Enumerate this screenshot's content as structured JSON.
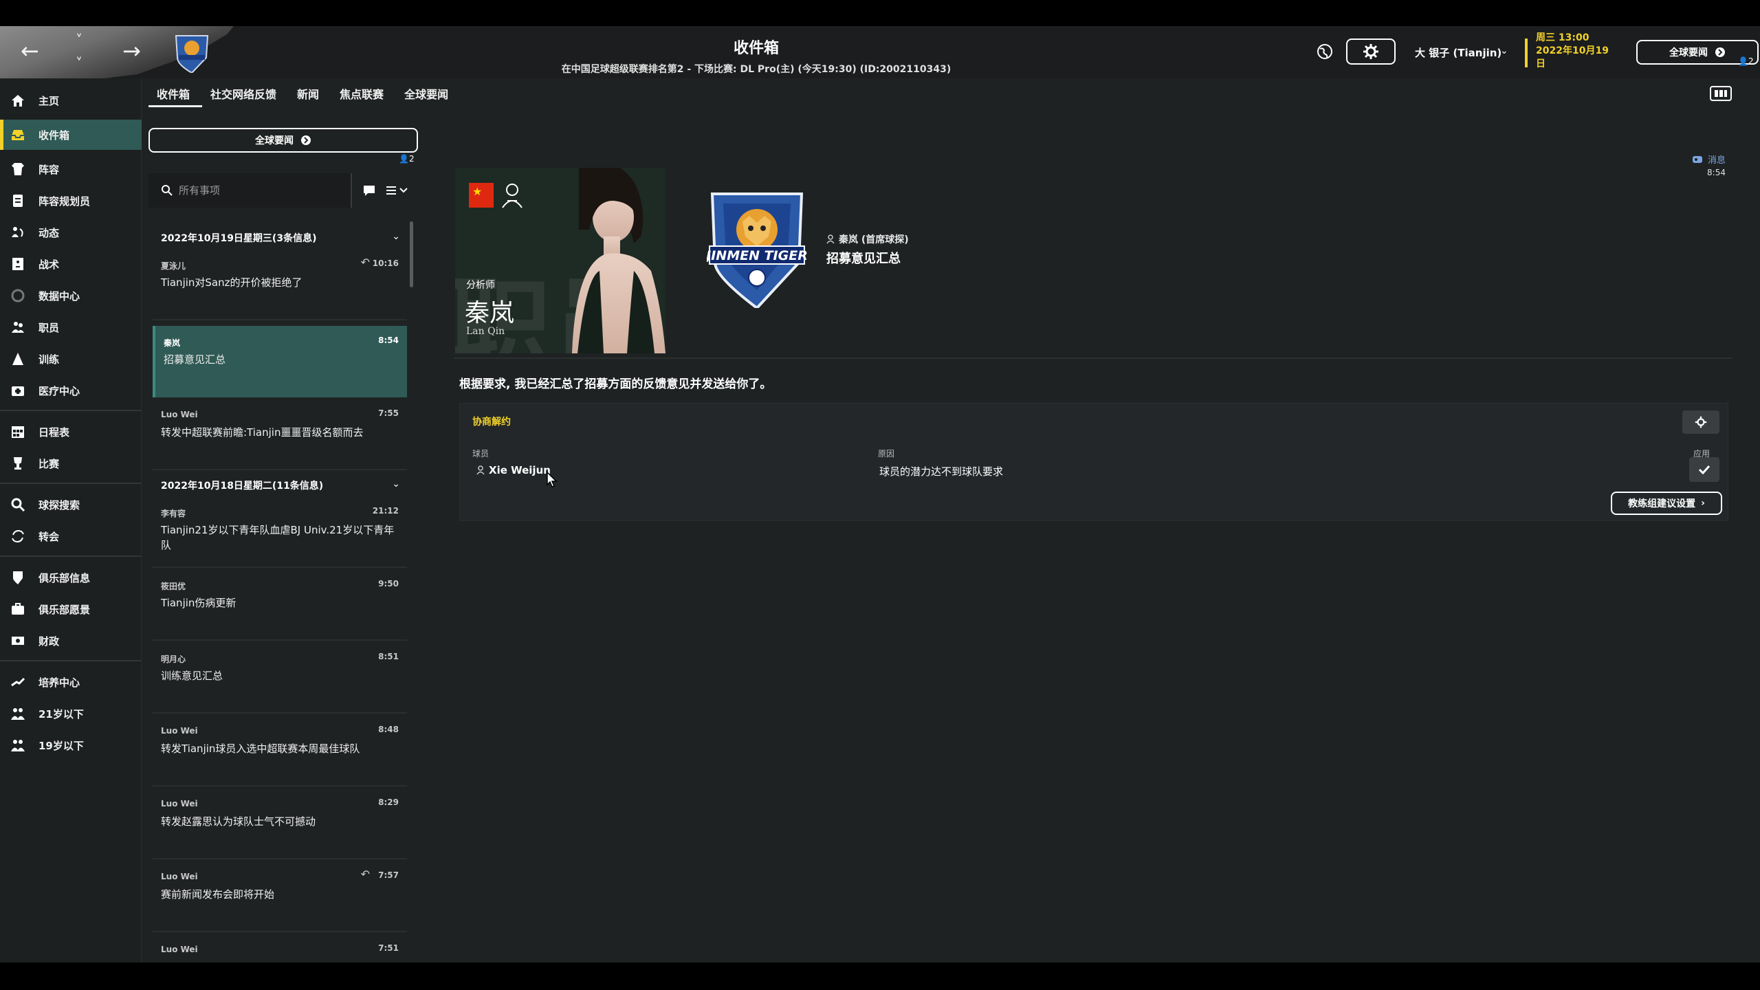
{
  "header": {
    "title": "收件箱",
    "subtitle": "在中国足球超级联赛排名第2 - 下场比赛: DL Pro(主) (今天19:30) (ID:2002110343)",
    "user_name": "大 银子 (Tianjin)",
    "date": "周三 13:00\n2022年10月19日",
    "news_button": "全球要闻",
    "news_badge": "2"
  },
  "sidebar": {
    "items": [
      {
        "label": "主页",
        "icon": "home-icon"
      },
      {
        "label": "收件箱",
        "icon": "inbox-icon"
      },
      {
        "label": "阵容",
        "icon": "squad-icon"
      },
      {
        "label": "阵容规划员",
        "icon": "planner-icon"
      },
      {
        "label": "动态",
        "icon": "dynamics-icon"
      },
      {
        "label": "战术",
        "icon": "tactics-icon"
      },
      {
        "label": "数据中心",
        "icon": "data-icon"
      },
      {
        "label": "职员",
        "icon": "staff-icon"
      },
      {
        "label": "训练",
        "icon": "training-icon"
      },
      {
        "label": "医疗中心",
        "icon": "medical-icon"
      },
      {
        "label": "日程表",
        "icon": "calendar-icon"
      },
      {
        "label": "比赛",
        "icon": "trophy-icon"
      },
      {
        "label": "球探搜索",
        "icon": "scout-icon"
      },
      {
        "label": "转会",
        "icon": "transfer-icon"
      },
      {
        "label": "俱乐部信息",
        "icon": "club-info-icon"
      },
      {
        "label": "俱乐部愿景",
        "icon": "club-vision-icon"
      },
      {
        "label": "财政",
        "icon": "finance-icon"
      },
      {
        "label": "培养中心",
        "icon": "development-icon"
      },
      {
        "label": "21岁以下",
        "icon": "u21-icon"
      },
      {
        "label": "19岁以下",
        "icon": "u19-icon"
      }
    ]
  },
  "tabs": [
    {
      "label": "收件箱"
    },
    {
      "label": "社交网络反馈"
    },
    {
      "label": "新闻"
    },
    {
      "label": "焦点联赛"
    },
    {
      "label": "全球要闻"
    }
  ],
  "inbox": {
    "news_button": "全球要闻",
    "badge": "2",
    "search_placeholder": "所有事项",
    "groups": [
      {
        "title": "2022年10月19日星期三(3条信息)"
      },
      {
        "title": "2022年10月18日星期二(11条信息)"
      }
    ],
    "messages": [
      {
        "sender": "夏泳儿",
        "time": "10:16",
        "subject": "Tianjin对Sanz的开价被拒绝了",
        "reply": true
      },
      {
        "sender": "秦岚",
        "time": "8:54",
        "subject": "招募意见汇总",
        "reply": false
      },
      {
        "sender": "Luo Wei",
        "time": "7:55",
        "subject": "转发中超联赛前瞻:Tianjin噩噩晋级名额而去",
        "reply": false
      },
      {
        "sender": "李有容",
        "time": "21:12",
        "subject": "Tianjin21岁以下青年队血虐BJ Univ.21岁以下青年队",
        "reply": false
      },
      {
        "sender": "筱田优",
        "time": "9:50",
        "subject": "Tianjin伤病更新",
        "reply": false
      },
      {
        "sender": "明月心",
        "time": "8:51",
        "subject": "训练意见汇总",
        "reply": false
      },
      {
        "sender": "Luo Wei",
        "time": "8:48",
        "subject": "转发Tianjin球员入选中超联赛本周最佳球队",
        "reply": false
      },
      {
        "sender": "Luo Wei",
        "time": "8:29",
        "subject": "转发赵露思认为球队士气不可撼动",
        "reply": false
      },
      {
        "sender": "Luo Wei",
        "time": "7:57",
        "subject": "赛前新闻发布会即将开始",
        "reply": true
      },
      {
        "sender": "Luo Wei",
        "time": "7:51",
        "subject": "",
        "reply": false
      }
    ]
  },
  "detail": {
    "message_type": "消息",
    "time": "8:54",
    "portrait_role": "分析师",
    "portrait_name": "秦岚",
    "portrait_pinyin": "Lan Qin",
    "crest_text": "JINMEN TIGER",
    "sender_line": "秦岚 (首席球探)",
    "subject": "招募意见汇总",
    "body": "根据要求, 我已经汇总了招募方面的反馈意见并发送给你了。",
    "panel": {
      "title": "协商解约",
      "col_player": "球员",
      "col_reason": "原因",
      "col_apply": "应用",
      "rows": [
        {
          "player": "Xie Weijun",
          "reason": "球员的潜力达不到球队要求"
        }
      ],
      "coach_button": "教练组建议设置"
    }
  },
  "colors": {
    "accent_yellow": "#f2d12a",
    "selected_teal": "#2f5a55",
    "background": "#1f2223"
  }
}
